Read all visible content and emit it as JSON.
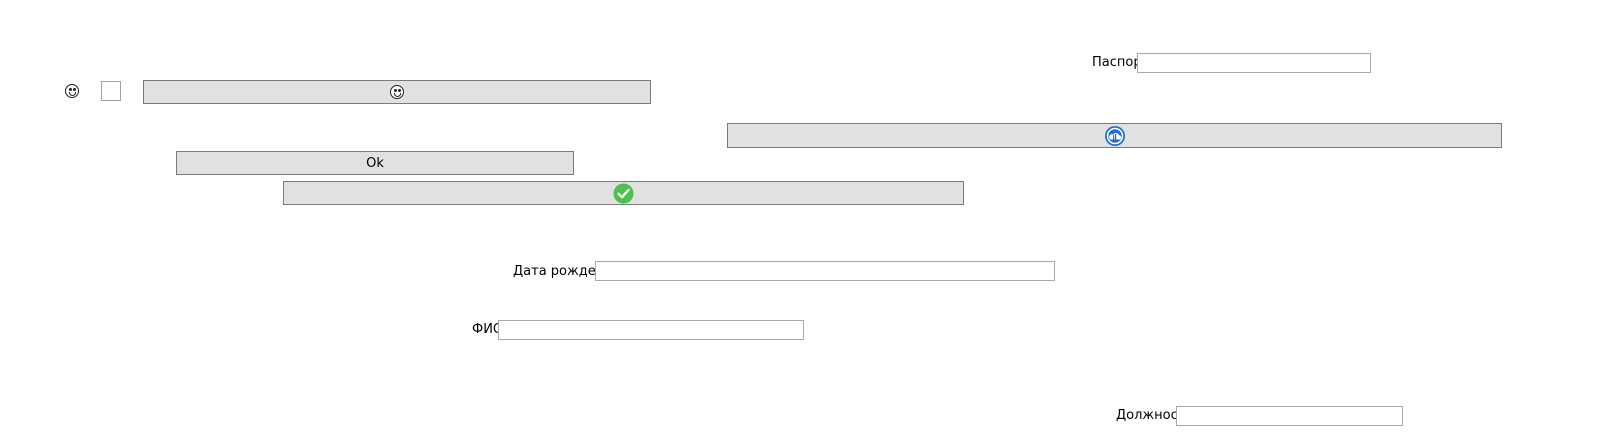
{
  "labels": {
    "passport": "Паспорт",
    "birth_date": "Дата рождения",
    "full_name": "ФИО",
    "position": "Должность"
  },
  "fields": {
    "passport_value": "",
    "birth_date_value": "",
    "full_name_value": "",
    "position_value": ""
  },
  "buttons": {
    "ok_label": "Ok",
    "emoji_button_icon": "laughing-face-icon",
    "cloud_button_icon": "blue-cloud-icon",
    "check_button_icon": "green-check-icon"
  },
  "toolbar": {
    "icons": [
      "laughing-face-icon",
      "grinning-face-icon"
    ]
  },
  "colors": {
    "button_bg": "#e1e1e1",
    "button_border": "#7a7a7a",
    "field_border": "#a9a9a9",
    "check_green": "#4cc24c",
    "cloud_blue": "#1e6fd0"
  }
}
